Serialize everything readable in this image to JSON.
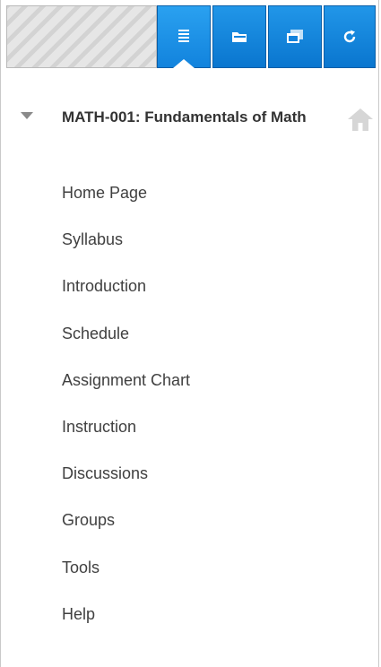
{
  "toolbar": {
    "tabs": [
      {
        "name": "course-menu-tab",
        "icon": "list-icon",
        "active": true
      },
      {
        "name": "folder-view-tab",
        "icon": "folder-icon",
        "active": false
      },
      {
        "name": "window-tab",
        "icon": "window-icon",
        "active": false
      },
      {
        "name": "refresh-tab",
        "icon": "refresh-icon",
        "active": false
      }
    ],
    "accent_color": "#1283dd"
  },
  "course": {
    "title": "MATH-001: Fundamentals of Math",
    "collapse_icon": "triangle-down-icon",
    "home_icon": "home-icon"
  },
  "menu": {
    "items": [
      "Home Page",
      "Syllabus",
      "Introduction",
      "Schedule",
      "Assignment Chart",
      "Instruction",
      "Discussions",
      "Groups",
      "Tools",
      "Help"
    ]
  }
}
